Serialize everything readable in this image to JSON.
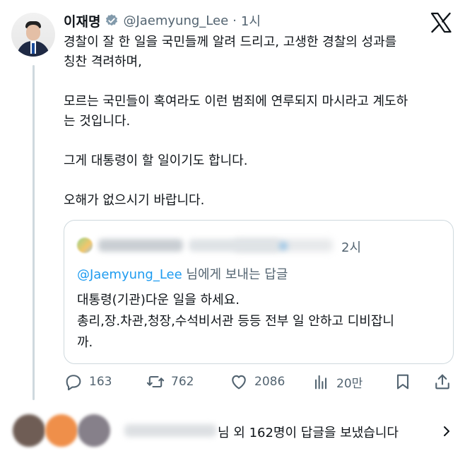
{
  "tweet": {
    "display_name": "이재명",
    "handle": "@Jaemyung_Lee",
    "separator": "·",
    "time": "1시",
    "verified_icon": "verified-badge-icon",
    "platform_icon": "x-logo-icon",
    "body_paragraphs": [
      [
        "경찰이 잘 한 일을 국민들께 알려 드리고, 고생한 경찰의 성과를",
        "칭찬 격려하며,"
      ],
      [
        "모르는 국민들이 혹여라도 이런 범죄에 연루되지 마시라고 계도하",
        "는 것입니다."
      ],
      [
        "그게 대통령이 할 일이기도 합니다."
      ],
      [
        "오해가 없으시기 바랍니다."
      ]
    ]
  },
  "quoted": {
    "time": "2시",
    "reply_mention": "@Jaemyung_Lee",
    "reply_suffix": " 님에게 보내는 답글",
    "lines": [
      "대통령(기관)다운 일을 하세요.",
      "총리,장.차관,청장,수석비서관 등등 전부 일 안하고  디비잡니",
      "까."
    ]
  },
  "actions": {
    "replies": "163",
    "reposts": "762",
    "likes": "2086",
    "views": "20만"
  },
  "replies_summary": {
    "text": "님 외 162명이 답글을 보냈습니다"
  },
  "colors": {
    "text": "#0f1419",
    "secondary": "#536471",
    "accent": "#1d9bf0",
    "border": "#cfd9de"
  }
}
